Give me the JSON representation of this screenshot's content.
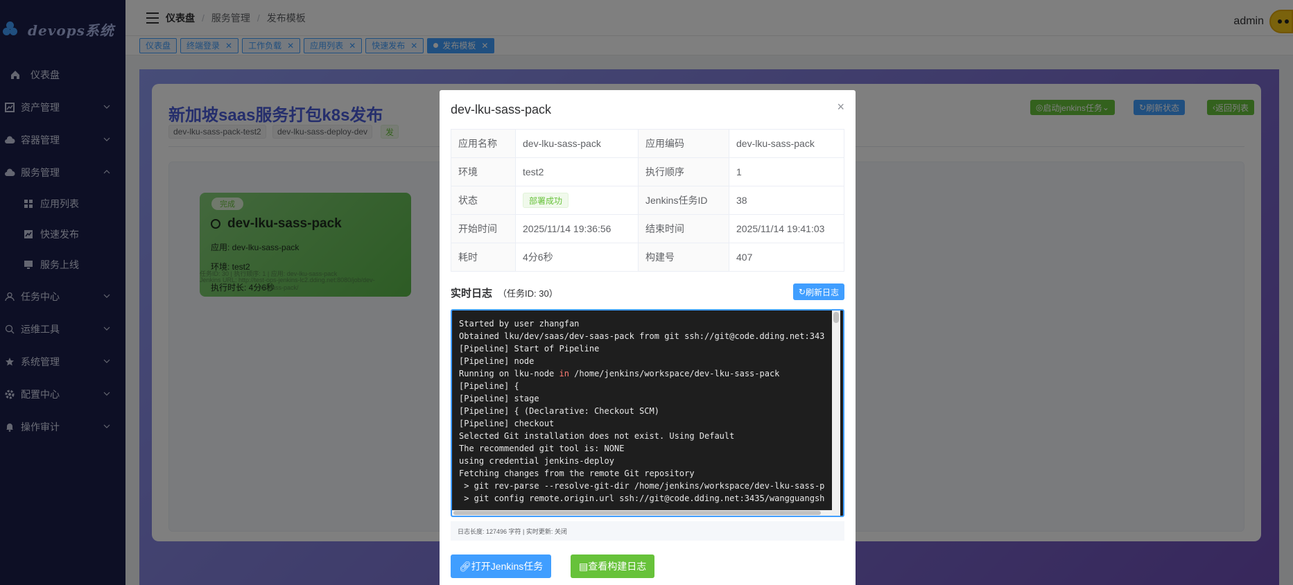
{
  "app": {
    "logo_text": "devops系统"
  },
  "sidebar": {
    "items": [
      {
        "label": "仪表盘",
        "icon": "home-icon"
      },
      {
        "label": "资产管理",
        "icon": "chart-icon"
      },
      {
        "label": "容器管理",
        "icon": "cloud-icon"
      },
      {
        "label": "服务管理",
        "icon": "cloud-icon"
      },
      {
        "label": "任务中心",
        "icon": "user-icon"
      },
      {
        "label": "运维工具",
        "icon": "search-icon"
      },
      {
        "label": "系统管理",
        "icon": "star-icon"
      },
      {
        "label": "配置中心",
        "icon": "gear-icon"
      },
      {
        "label": "操作审计",
        "icon": "bell-icon"
      }
    ],
    "sub_items": [
      {
        "label": "应用列表",
        "icon": "grid-icon"
      },
      {
        "label": "快速发布",
        "icon": "chart-icon"
      },
      {
        "label": "服务上线",
        "icon": "monitor-icon"
      }
    ]
  },
  "header": {
    "breadcrumb": [
      "仪表盘",
      "服务管理",
      "发布模板"
    ],
    "user": "admin"
  },
  "tags": [
    "仪表盘",
    "终端登录",
    "工作负载",
    "应用列表",
    "快速发布",
    "发布模板"
  ],
  "page": {
    "title": "新加坡saas服务打包k8s发布",
    "chips": [
      "dev-lku-sass-pack-test2",
      "dev-lku-sass-deploy-dev",
      "发"
    ],
    "buttons": {
      "start": "启动jenkins任务",
      "refresh": "刷新状态",
      "back": "返回列表"
    }
  },
  "card": {
    "badge": "完成",
    "title": "dev-lku-sass-pack",
    "app_line": "应用: dev-lku-sass-pack",
    "env_line": "环境: test2",
    "duration_line": "执行时长: 4分6秒",
    "faint_1": "任务ID: 30 | 执行顺序: 1 | 应用: dev-lku-sass-pack",
    "faint_2": "Jenkins URL: http://test-ops-jenkins-lc2.dding.net:8080/job/dev-",
    "faint_3": "lku-sass-pack/"
  },
  "modal": {
    "title": "dev-lku-sass-pack",
    "close": "×",
    "rows": [
      {
        "k1": "应用名称",
        "v1": "dev-lku-sass-pack",
        "k2": "应用编码",
        "v2": "dev-lku-sass-pack"
      },
      {
        "k1": "环境",
        "v1": "test2",
        "k2": "执行顺序",
        "v2": "1"
      },
      {
        "k1": "状态",
        "v1": "部署成功",
        "k2": "Jenkins任务ID",
        "v2": "38"
      },
      {
        "k1": "开始时间",
        "v1": "2025/11/14 19:36:56",
        "k2": "结束时间",
        "v2": "2025/11/14 19:41:03"
      },
      {
        "k1": "耗时",
        "v1": "4分6秒",
        "k2": "构建号",
        "v2": "407"
      }
    ],
    "log_title": "实时日志",
    "log_sub": "（任务ID: 30）",
    "refresh_log": "刷新日志",
    "log_lines": [
      "Started by user zhangfan",
      "Obtained lku/dev/saas/dev-saas-pack from git ssh://git@code.dding.net:343",
      "[Pipeline] Start of Pipeline",
      "[Pipeline] node",
      "Running on lku-node in /home/jenkins/workspace/dev-lku-sass-pack",
      "[Pipeline] {",
      "[Pipeline] stage",
      "[Pipeline] { (Declarative: Checkout SCM)",
      "[Pipeline] checkout",
      "Selected Git installation does not exist. Using Default",
      "The recommended git tool is: NONE",
      "using credential jenkins-deploy",
      "Fetching changes from the remote Git repository",
      " > git rev-parse --resolve-git-dir /home/jenkins/workspace/dev-lku-sass-p",
      " > git config remote.origin.url ssh://git@code.dding.net:3435/wangguangsh"
    ],
    "log_footer": "日志长度: 127496 字符 | 实时更新: 关闭",
    "btn_jenkins": "打开Jenkins任务",
    "btn_build_log": "查看构建日志"
  }
}
